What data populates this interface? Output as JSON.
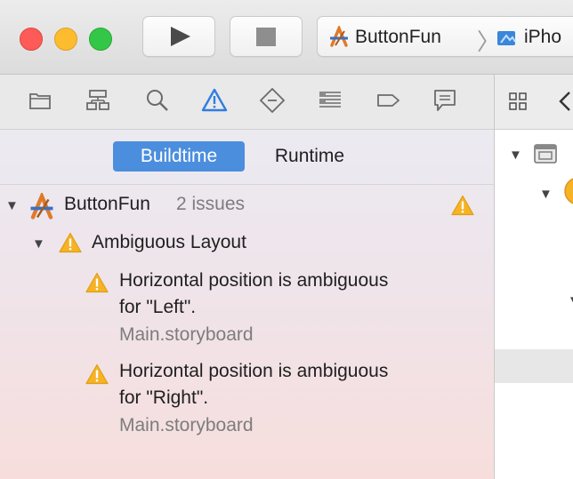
{
  "window": {
    "traffic_lights": {
      "close": "#fc5b57",
      "minimize": "#fdbc2e",
      "zoom": "#33c748"
    },
    "run_icon": "play-icon",
    "stop_icon": "stop-icon",
    "scheme": {
      "project": "ButtonFun",
      "separator": "〉",
      "device": "iPho"
    }
  },
  "navigator_icons": [
    "folder-icon",
    "hierarchy-icon",
    "search-icon",
    "warning-icon",
    "diamond-icon",
    "list-icon",
    "tag-icon",
    "comment-icon"
  ],
  "segmented": {
    "buildtime": "Buildtime",
    "runtime": "Runtime",
    "selected": "Buildtime",
    "accent": "#4c8ede"
  },
  "issues": {
    "project": "ButtonFun",
    "count_label": "2 issues",
    "group": "Ambiguous Layout",
    "items": [
      {
        "line1": "Horizontal position is ambiguous",
        "line2": "for \"Left\".",
        "file": "Main.storyboard"
      },
      {
        "line1": "Horizontal position is ambiguous",
        "line2": "for \"Right\".",
        "file": "Main.storyboard"
      }
    ]
  },
  "colors": {
    "warning": "#f5b325"
  }
}
